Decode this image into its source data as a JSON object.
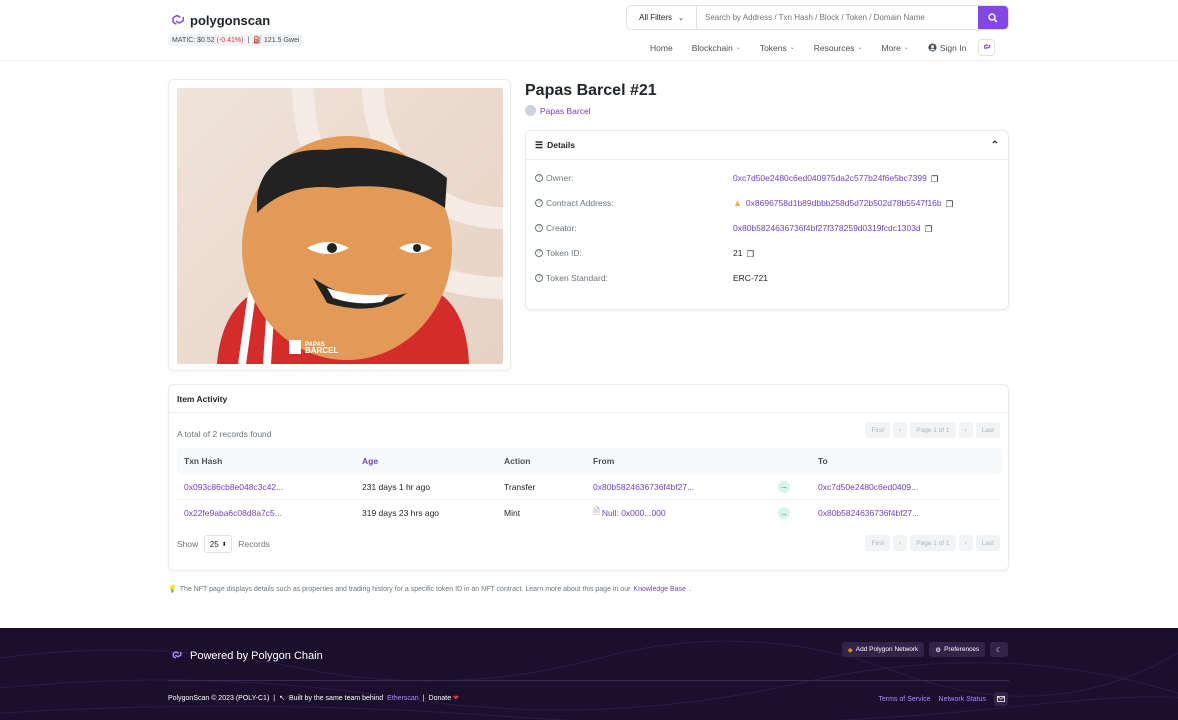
{
  "header": {
    "brand": "polygonscan",
    "price_label": "MATIC: $0.52",
    "price_change": "(-0.41%)",
    "price_sep": "|",
    "gas": "121.5 Gwei",
    "filter_label": "All Filters",
    "search_placeholder": "Search by Address / Txn Hash / Block / Token / Domain Name",
    "nav": {
      "home": "Home",
      "blockchain": "Blockchain",
      "tokens": "Tokens",
      "resources": "Resources",
      "more": "More",
      "signin": "Sign In"
    }
  },
  "nft": {
    "title": "Papas Barcel #21",
    "collection": "Papas Barcel",
    "image_text": [
      "PAPAS",
      "BARCEL"
    ]
  },
  "details": {
    "heading": "Details",
    "rows": [
      {
        "label": "Owner:",
        "value": "0xc7d50e2480c6ed040975da2c577b24f6e5bc7399"
      },
      {
        "label": "Contract Address:",
        "value": "0x8696758d1b89dbbb258d5d72b502d78b5547f16b"
      },
      {
        "label": "Creator:",
        "value": "0x80b5824636736f4bf27f378259d0319fcdc1303d"
      },
      {
        "label": "Token ID:",
        "value": "21"
      },
      {
        "label": "Token Standard:",
        "value": "ERC-721"
      }
    ]
  },
  "activity": {
    "heading": "Item Activity",
    "found": "A total of 2 records found",
    "pager": {
      "first": "First",
      "prev": "‹",
      "page": "Page 1 of 1",
      "next": "›",
      "last": "Last"
    },
    "columns": {
      "hash": "Txn Hash",
      "age": "Age",
      "action": "Action",
      "from": "From",
      "to": "To"
    },
    "rows": [
      {
        "hash": "0x093c86cb8e048c3c42...",
        "age": "231 days 1 hr ago",
        "action": "Transfer",
        "from": "0x80b5824636736f4bf27...",
        "to": "0xc7d50e2480c6ed0409..."
      },
      {
        "hash": "0x22fe9aba6c08d8a7c5...",
        "age": "319 days 23 hrs ago",
        "action": "Mint",
        "from": "Null: 0x000...000",
        "to": "0x80b5824636736f4bf27..."
      }
    ],
    "show_label": "Show",
    "show_value": "25",
    "records_label": "Records"
  },
  "note": {
    "text": "The NFT page displays details such as properties and trading history for a specific token ID in an NFT contract. Learn more about this page in our",
    "link": "Knowledge Base",
    "end": "."
  },
  "footer": {
    "powered": "Powered by Polygon Chain",
    "add_network": "Add Polygon Network",
    "preferences": "Preferences",
    "copyright": "PolygonScan © 2023 (POLY-C1)",
    "sep": "|",
    "built": "Built by the same team behind",
    "etherscan": "Etherscan",
    "donate": "Donate",
    "terms": "Terms of Service",
    "status": "Network Status"
  },
  "colors": {
    "accent": "#8247e5",
    "link": "#6f42c1",
    "footer_bg": "#1b0f2e"
  },
  "icons": [
    "polygon-logo-icon",
    "search-icon",
    "chevron-down-icon",
    "user-circle-icon",
    "list-icon",
    "question-circle-icon",
    "copy-icon",
    "warning-icon",
    "arrow-right-icon",
    "document-icon",
    "bulb-icon",
    "moon-icon",
    "gear-icon",
    "mail-icon",
    "heart-icon"
  ]
}
